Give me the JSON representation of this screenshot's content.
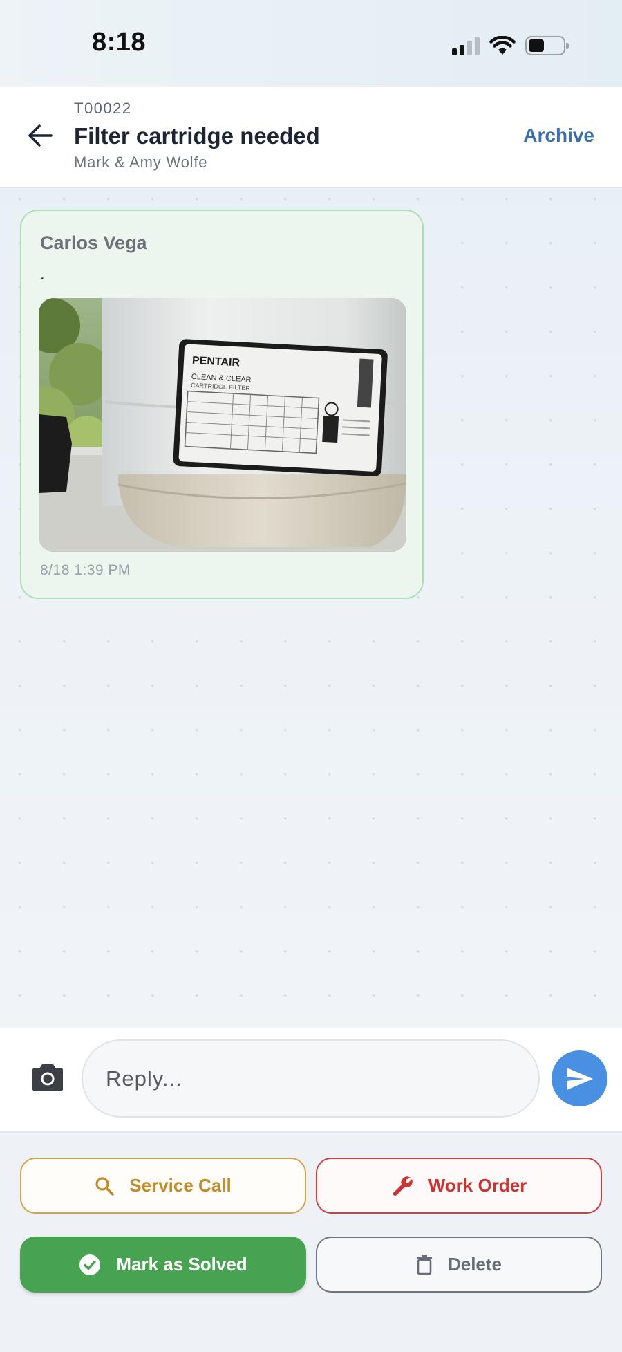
{
  "status_bar": {
    "time": "8:18"
  },
  "header": {
    "ticket_id": "T00022",
    "title": "Filter cartridge needed",
    "subtitle": "Mark & Amy Wolfe",
    "archive_label": "Archive"
  },
  "message": {
    "sender": "Carlos Vega",
    "text": ".",
    "timestamp": "8/18 1:39 PM",
    "photo": {
      "brand": "PENTAIR",
      "product_line1": "CLEAN & CLEAR",
      "product_line2": "CARTRIDGE FILTER"
    }
  },
  "composer": {
    "placeholder": "Reply..."
  },
  "actions": {
    "service_call": "Service Call",
    "work_order": "Work Order",
    "mark_solved": "Mark as Solved",
    "delete": "Delete"
  },
  "colors": {
    "accent_blue": "#4a90e2",
    "archive_blue": "#3a6fb0",
    "bubble_bg": "#ecf6ee",
    "bubble_border": "#a9e1b4",
    "service_call": "#c38c2a",
    "work_order": "#cc3434",
    "solved_green": "#47a352",
    "delete_gray": "#676d78"
  },
  "icons": {
    "back": "arrow-left-icon",
    "camera": "camera-icon",
    "send": "send-icon",
    "service_call": "search-icon",
    "work_order": "wrench-icon",
    "solved": "check-circle-icon",
    "delete": "trash-icon"
  }
}
